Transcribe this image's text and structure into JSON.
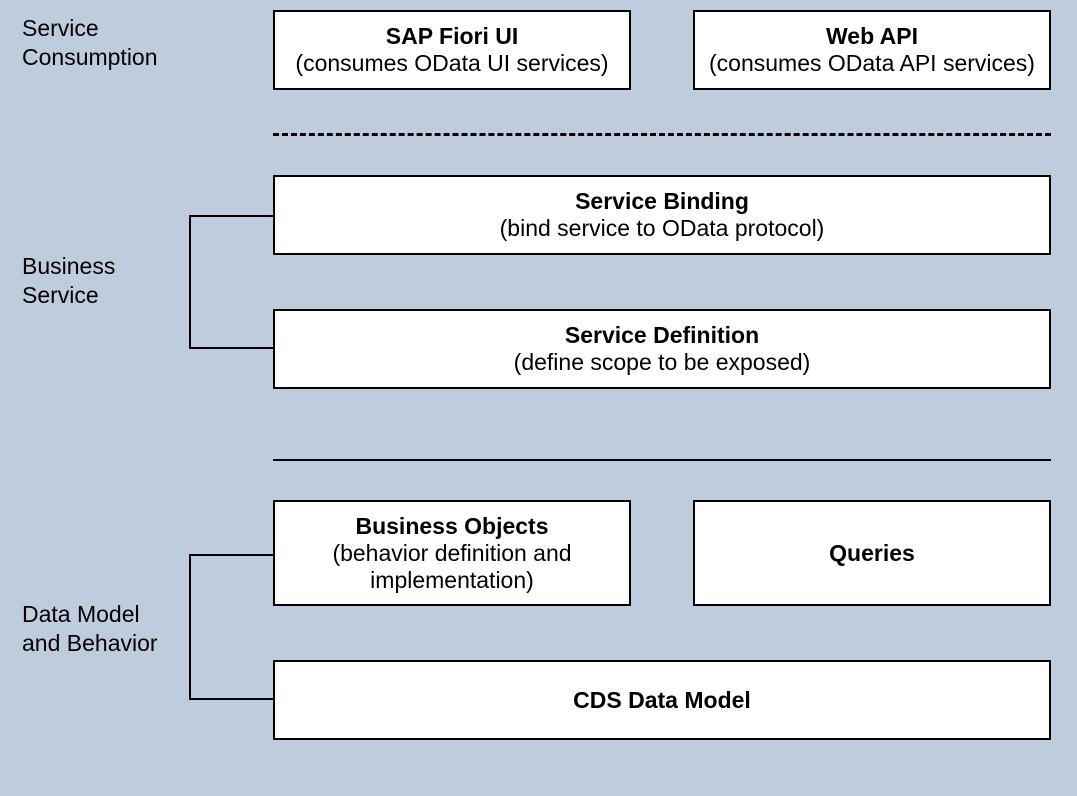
{
  "sections": {
    "consumption": {
      "label1": "Service",
      "label2": "Consumption"
    },
    "business": {
      "label1": "Business",
      "label2": "Service"
    },
    "datamodel": {
      "label1": "Data Model",
      "label2": "and Behavior"
    }
  },
  "boxes": {
    "fiori": {
      "title": "SAP Fiori UI",
      "sub": "(consumes OData UI services)"
    },
    "webapi": {
      "title": "Web API",
      "sub": "(consumes OData API services)"
    },
    "binding": {
      "title": "Service Binding",
      "sub": "(bind service to OData protocol)"
    },
    "defn": {
      "title": "Service Definition",
      "sub": "(define scope to be exposed)"
    },
    "bobjects": {
      "title": "Business Objects",
      "sub1": "(behavior definition and",
      "sub2": "implementation)"
    },
    "queries": {
      "title": "Queries"
    },
    "cds": {
      "title": "CDS Data Model"
    }
  }
}
